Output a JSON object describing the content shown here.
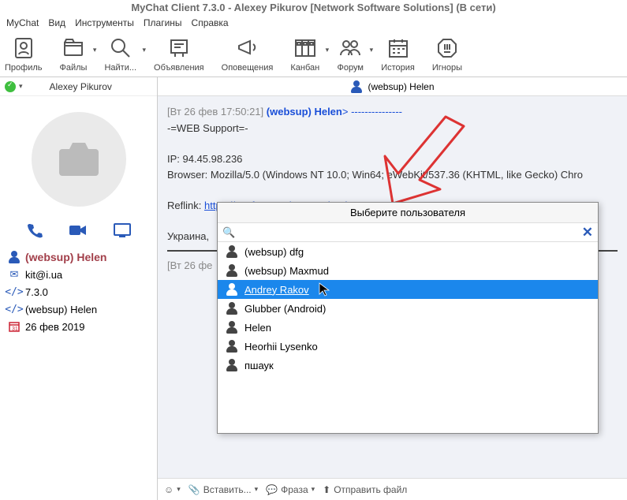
{
  "title": "MyChat Client 7.3.0 - Alexey Pikurov [Network Software Solutions] (В сети)",
  "menu": [
    "MyChat",
    "Вид",
    "Инструменты",
    "Плагины",
    "Справка"
  ],
  "toolbar": [
    {
      "label": "Профиль",
      "chev": false
    },
    {
      "label": "Файлы",
      "chev": true
    },
    {
      "label": "Найти...",
      "chev": true
    },
    {
      "label": "Объявления",
      "chev": false
    },
    {
      "label": "Оповещения",
      "chev": false
    },
    {
      "label": "Канбан",
      "chev": true
    },
    {
      "label": "Форум",
      "chev": true
    },
    {
      "label": "История",
      "chev": false
    },
    {
      "label": "Игноры",
      "chev": false
    }
  ],
  "sidebar": {
    "status_name": "Alexey Pikurov",
    "contact_name": "(websup) Helen",
    "email": "kit@i.ua",
    "version": "7.3.0",
    "group": "(websup) Helen",
    "date": "26 фев 2019"
  },
  "chat": {
    "header_name": "(websup) Helen",
    "ts1": "[Вт 26 фев 17:50:21]",
    "from1": "(websup) Helen",
    "arrow1": "> ---------------",
    "line_support": "-=WEB Support=-",
    "line_ip": "IP: 94.45.98.236",
    "line_browser": "Browser: Mozilla/5.0 (Windows NT 10.0; Win64;             eWebKit/537.36 (KHTML, like Gecko) Chro",
    "reflink_label": "Reflink:",
    "reflink_url": "https://nsoft-s.com/support.html",
    "location": "Украина,",
    "ts2": "[Вт 26 фе"
  },
  "input_bar": {
    "insert": "Вставить...",
    "phrase": "Фраза",
    "send_file": "Отправить файл"
  },
  "popup": {
    "title": "Выберите пользователя",
    "items": [
      {
        "label": "(websup) dfg",
        "selected": false
      },
      {
        "label": "(websup) Maxmud",
        "selected": false
      },
      {
        "label": "Andrey Rakov",
        "selected": true
      },
      {
        "label": "Glubber (Android)",
        "selected": false
      },
      {
        "label": "Helen",
        "selected": false
      },
      {
        "label": "Heorhii Lysenko",
        "selected": false
      },
      {
        "label": "пшаук",
        "selected": false
      }
    ]
  }
}
